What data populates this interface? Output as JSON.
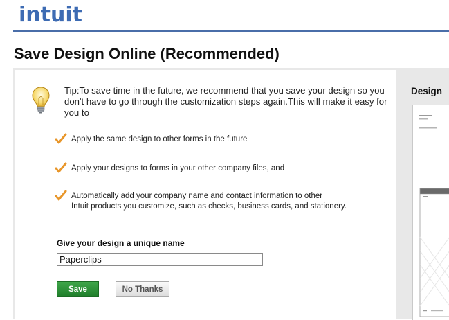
{
  "header": {
    "logo_text": "intuit"
  },
  "page": {
    "title": "Save Design Online (Recommended)"
  },
  "tip": {
    "text": "Tip:To save time in the future, we recommend that you save your design so you don't have to go through the customization steps again.This will make it easy for you to"
  },
  "bullets": [
    {
      "line1": "Apply the same design to other forms in the future",
      "line2": ""
    },
    {
      "line1": "Apply your designs to forms in your other company files, and",
      "line2": ""
    },
    {
      "line1": "Automatically add your company name and contact information to other",
      "line2": "Intuit products you customize, such as checks, business cards, and stationery."
    }
  ],
  "form": {
    "name_label": "Give your design a unique name",
    "name_value": "Paperclips"
  },
  "buttons": {
    "save_label": "Save",
    "no_thanks_label": "No Thanks"
  },
  "preview": {
    "title": "Design"
  },
  "icons": {
    "bulb": "lightbulb-icon",
    "check": "checkmark-icon"
  }
}
